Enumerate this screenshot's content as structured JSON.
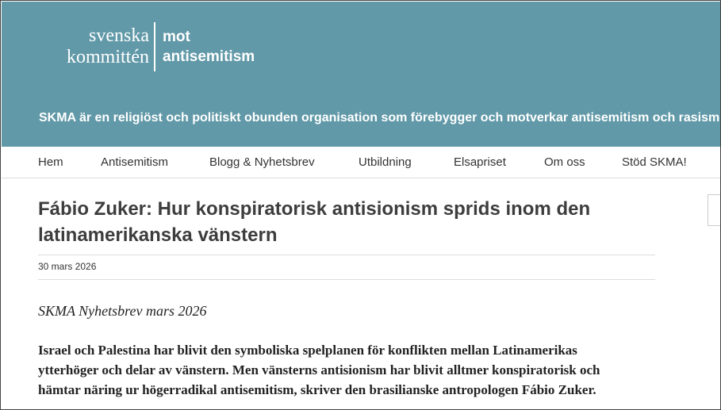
{
  "header": {
    "logo_line1": "svenska",
    "logo_line2": "kommittén",
    "logo_right1": "mot",
    "logo_right2": "antisemitism",
    "tagline": "SKMA är en religiöst och politiskt obunden organisation som förebygger och motverkar antisemitism och rasism",
    "background_color": "#6199a8"
  },
  "nav": {
    "items": [
      {
        "label": "Hem"
      },
      {
        "label": "Antisemitism"
      },
      {
        "label": "Blogg & Nyhetsbrev"
      },
      {
        "label": "Utbildning"
      },
      {
        "label": "Elsapriset"
      },
      {
        "label": "Om oss"
      },
      {
        "label": "Stöd SKMA!"
      }
    ]
  },
  "article": {
    "title_line1": "Fábio Zuker: Hur konspiratorisk antisionism sprids inom den",
    "title_line2": "latinamerikanska vänstern",
    "date": "30 mars 2026",
    "subhead": "SKMA Nyhetsbrev mars 2026",
    "lead_lines": [
      "Israel och Palestina har blivit den symboliska spelplanen för konflikten mellan Latinamerikas",
      "ytterhöger och delar av vänstern. Men vänsterns antisionism har blivit alltmer konspiratorisk och",
      "hämtar näring ur högerradikal antisemitism, skriver den brasilianske antropologen Fábio Zuker."
    ]
  }
}
